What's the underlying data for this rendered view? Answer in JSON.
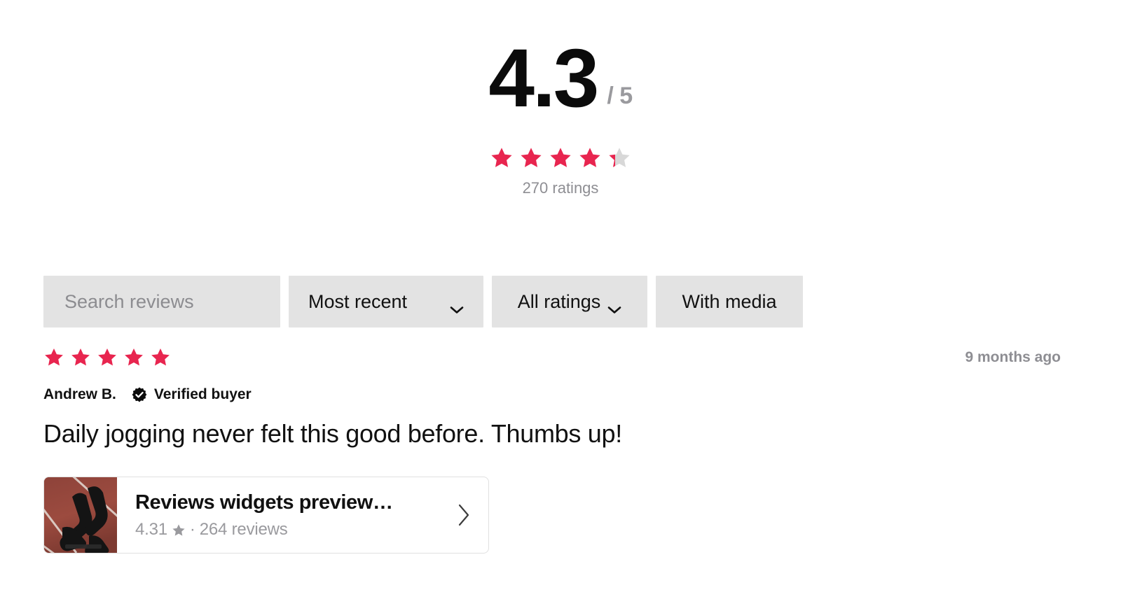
{
  "summary": {
    "score": "4.3",
    "out_of": "/ 5",
    "star_rating": 4.3,
    "ratings_count_label": "270 ratings",
    "star_color": "#e8254f",
    "star_empty_color": "#d8d8d8"
  },
  "filters": {
    "search_placeholder": "Search reviews",
    "search_value": "",
    "sort_label": "Most recent",
    "ratings_label": "All ratings",
    "media_label": "With media",
    "chevron_down_icon": "chevron-down-icon"
  },
  "review": {
    "stars": 5,
    "date": "9 months ago",
    "author": "Andrew B.",
    "verified_icon": "verified-badge-icon",
    "verified_label": "Verified buyer",
    "text": "Daily jogging never felt this good before. Thumbs up!",
    "product": {
      "title": "Reviews widgets preview…",
      "rating": "4.31",
      "star_icon": "star-icon",
      "separator": "·",
      "reviews_label": "264 reviews",
      "arrow_icon": "chevron-right-icon",
      "thumbnail_alt": "sprinter-in-starting-blocks-on-track"
    }
  }
}
